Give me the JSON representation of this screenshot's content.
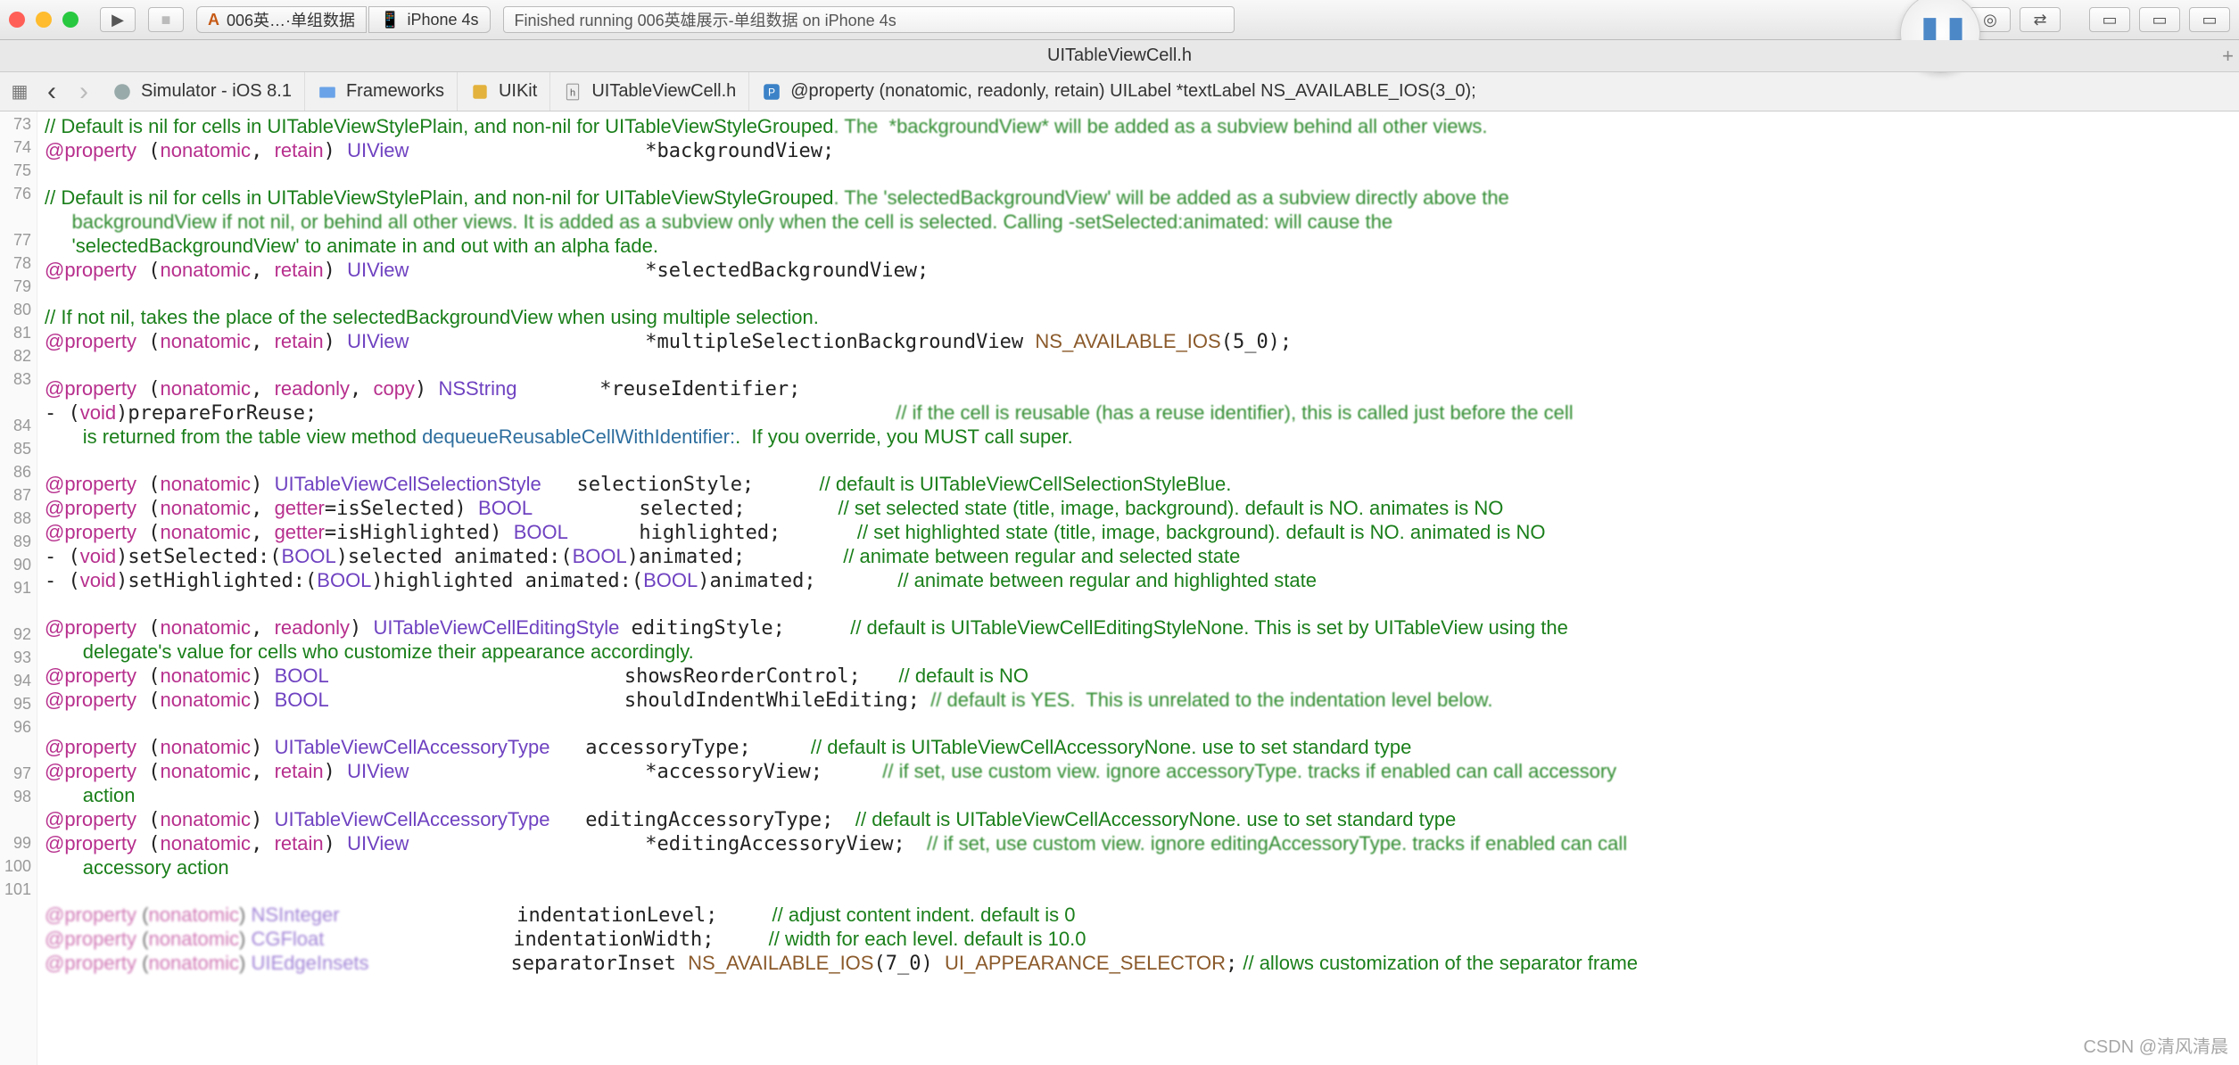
{
  "toolbar": {
    "scheme_name": "006英…·单组数据",
    "device": "iPhone 4s",
    "status": "Finished running 006英雄展示-单组数据 on iPhone 4s",
    "play_icon": "▶",
    "stop_icon": "■",
    "phone_icon": "📱",
    "app_icon": "A"
  },
  "tab": {
    "title": "UITableViewCell.h",
    "plus": "+"
  },
  "jumpbar": {
    "grid_icon": "▦",
    "back": "‹",
    "fwd": "›",
    "simulator": "Simulator - iOS 8.1",
    "frameworks": "Frameworks",
    "uikit": "UIKit",
    "file": "UITableViewCell.h",
    "symbol": "@property (nonatomic, readonly, retain) UILabel *textLabel NS_AVAILABLE_IOS(3_0);"
  },
  "record": {
    "glyph": "❚❚"
  },
  "right_icons": {
    "toc": "≡",
    "eye": "◎",
    "swap": "⇄",
    "p1": "▭",
    "p2": "▭",
    "p3": "▭"
  },
  "watermark": "CSDN @清风清晨",
  "gutter": [
    "73",
    "74",
    "75",
    "76",
    "",
    "77",
    "78",
    "79",
    "80",
    "81",
    "82",
    "83",
    "",
    "84",
    "85",
    "86",
    "87",
    "88",
    "89",
    "90",
    "91",
    "",
    "92",
    "93",
    "94",
    "95",
    "96",
    "",
    "97",
    "98",
    "",
    "99",
    "100",
    "101"
  ],
  "code": {
    "l1a": "// Default is ",
    "l1b": "nil",
    "l1c": " for cells in ",
    "l1d": "UITableViewStylePlain",
    "l1e": ", and non-nil for ",
    "l1f": "UITableViewStyleGrouped",
    "l1g": ". The  *backgroundView* will be added as a subview behind all other views.",
    "l2a": "@property",
    "l2b": " (",
    "l2c": "nonatomic",
    "l2d": ", ",
    "l2e": "retain",
    "l2f": ") ",
    "l2g": "UIView",
    "l2h": "                    *backgroundView;",
    "blank": "",
    "l3a": "// Default is nil for cells in ",
    "l3b": "UITableViewStylePlain",
    "l3c": ", and non-nil for ",
    "l3d": "UITableViewStyleGrouped",
    "l3e": ". The 'selectedBackgroundView' will be added as a subview directly above the",
    "l3f": "     backgroundView if not nil, or behind all other views. It is added as a subview only when the cell is selected. Calling -setSelected:animated: will cause the",
    "l3g": "     'selectedBackgroundView' to animate in and out with an alpha fade.",
    "l4h": "                    *selectedBackgroundView;",
    "l5a": "// If not nil, takes the place of the selectedBackgroundView when using multiple selection.",
    "l6h": "                    *multipleSelectionBackgroundView ",
    "l6m": "NS_AVAILABLE_IOS",
    "l6t": "(5_0);",
    "l7r": "readonly",
    "l7c": "copy",
    "l7t": "NSString",
    "l7h": "       *reuseIdentifier;",
    "l8a": "- (",
    "l8b": "void",
    "l8c": ")prepareForReuse;",
    "l8d": "                                                 ",
    "l8e": "// if the cell is reusable (has a reuse identifier), this is called just before the cell",
    "l8f": "       is returned from the table view method ",
    "l8g": "dequeueReusableCellWithIdentifier:",
    "l8h": ".  If you override, you MUST call super.",
    "l9t": "UITableViewCellSelectionStyle",
    "l9h": "   selectionStyle;",
    "l9c": "            // default is UITableViewCellSelectionStyleBlue.",
    "l10g": "getter",
    "l10s": "=isSelected) ",
    "l10t": "BOOL",
    "l10h": "         selected;",
    "l10c": "                 // set selected state (title, image, background). default is NO. animates is NO",
    "l11s": "=isHighlighted) ",
    "l11h": "      highlighted;",
    "l11c": "              // set highlighted state (title, image, background). default is NO. animated is NO",
    "l12a": "- (",
    "l12b": "void",
    "l12c": ")setSelected:(",
    "l12d": "BOOL",
    "l12e": ")selected animated:(",
    "l12f": "BOOL",
    "l12g": ")animated;",
    "l12h": "                  // animate between regular and selected state",
    "l13c": ")setHighlighted:(",
    "l13e": ")highlighted animated:(",
    "l13g": ")animated;",
    "l13h": "               // animate between regular and highlighted state",
    "l14t": "UITableViewCellEditingStyle",
    "l14h": " editingStyle;",
    "l14c": "            // default is UITableViewCellEditingStyleNone. This is set by UITableView using the",
    "l14d": "       delegate's value for cells who customize their appearance accordingly.",
    "l15h": "                         showsReorderControl;",
    "l15c": "       // default is NO",
    "l16h": "                         shouldIndentWhileEditing;",
    "l16c": "  // default is YES.  This is unrelated to the indentation level below.",
    "l17t": "UITableViewCellAccessoryType",
    "l17h": "   accessoryType;",
    "l17c": "           // default is UITableViewCellAccessoryNone. use to set standard type",
    "l18h": "                    *accessoryView;",
    "l18c": "           // if set, use custom view. ignore accessoryType. tracks if enabled can call accessory",
    "l18d": "       action",
    "l19h": "   editingAccessoryType;",
    "l19c": "    // default is UITableViewCellAccessoryNone. use to set standard type",
    "l20h": "                    *editingAccessoryView;",
    "l20c": "    // if set, use custom view. ignore editingAccessoryType. tracks if enabled can call",
    "l20d": "       accessory action",
    "l21t": "NSInteger",
    "l21h": "               indentationLevel;",
    "l21c": "          // adjust content indent. default is 0",
    "l22t": "CGFloat",
    "l22h": "                indentationWidth;",
    "l22c": "          // width for each level. default is 10.0",
    "l23t": "UIEdgeInsets",
    "l23h": "            separatorInset ",
    "l23m": "NS_AVAILABLE_IOS",
    "l23n": "(7_0) ",
    "l23o": "UI_APPEARANCE_SELECTOR",
    "l23p": ";",
    "l23c": " // allows customization of the separator frame"
  }
}
